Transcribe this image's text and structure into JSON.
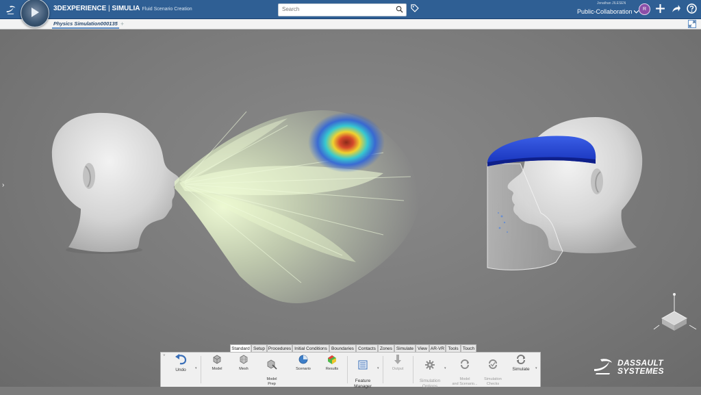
{
  "header": {
    "brand": "3DEXPERIENCE",
    "separator": " | ",
    "app": "SIMULIA",
    "app_sub": "Fluid Scenario Creation",
    "search_placeholder": "Search",
    "user_name": "Jonathan JILESEN",
    "collab_space": "Public-Collaboration",
    "avatar_text": "R",
    "icons": [
      "search-icon",
      "tag-icon",
      "chevron-down-icon",
      "plus-icon",
      "share-icon",
      "help-icon"
    ],
    "accent": "#2f5f94"
  },
  "tabbar": {
    "active_tab": "Physics Simulation000135",
    "add_label": "+"
  },
  "viewport": {
    "watermark_line1": "DASSAULT",
    "watermark_line2": "SYSTEMES",
    "left_arrow": "›"
  },
  "toolbar": {
    "tabs": [
      "Standard",
      "Setup",
      "Procedures",
      "Initial Conditions",
      "Boundaries",
      "Contacts",
      "Zones",
      "Simulate",
      "View",
      "AR-VR",
      "Tools",
      "Touch"
    ],
    "active_tab": "Standard",
    "commands": [
      {
        "label": "Undo",
        "icon": "undo-icon"
      },
      {
        "label": "Model",
        "icon": "model-icon"
      },
      {
        "label": "Mesh",
        "icon": "mesh-icon"
      },
      {
        "label": "Model\nPrep",
        "icon": "model-prep-icon"
      },
      {
        "label": "Scenario",
        "icon": "scenario-icon"
      },
      {
        "label": "Results",
        "icon": "results-icon"
      },
      {
        "label": "Feature\nManager",
        "icon": "feature-manager-icon"
      },
      {
        "label": "Output",
        "icon": "output-icon"
      },
      {
        "label": "Simulation\nOptions",
        "icon": "simulation-options-icon"
      },
      {
        "label": "Model\nand Scenario...",
        "icon": "model-scenario-icon"
      },
      {
        "label": "Simulation\nChecks",
        "icon": "simulation-checks-icon"
      },
      {
        "label": "Simulate",
        "icon": "simulate-icon"
      }
    ]
  }
}
